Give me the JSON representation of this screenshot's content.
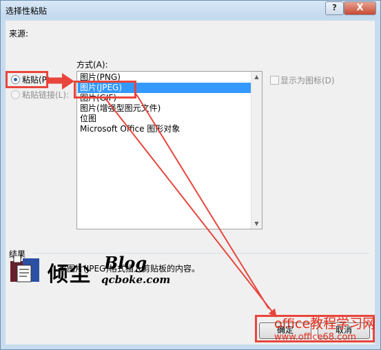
{
  "window": {
    "title": "选择性粘贴",
    "help_label": "?",
    "close_label": "X"
  },
  "source": {
    "label": "来源:"
  },
  "options": {
    "paste_label": "粘贴(P):",
    "paste_link_label": "粘贴链接(L):",
    "paste_selected": true
  },
  "format": {
    "label": "方式(A):",
    "items": [
      "图片(PNG)",
      "图片(JPEG)",
      "图片(GIF)",
      "图片(增强型图元文件)",
      "位图",
      "Microsoft Office 图形对象"
    ],
    "selected_index": 1
  },
  "display_as_icon": {
    "label": "显示为图标(D)",
    "checked": false
  },
  "result": {
    "label": "结果",
    "text": "以图片(JPEG)格式插入剪贴板的内容。"
  },
  "buttons": {
    "ok_label": "确定",
    "cancel_label": "取消"
  },
  "logo": {
    "chinese": "倾尘",
    "blog": "Blog",
    "domain": "qcboke.com"
  },
  "watermark": {
    "line1": "office教程学习网",
    "line2": "www.office68.com"
  },
  "colors": {
    "accent": "#3399ff",
    "annotation_red": "#e8453c",
    "close_button": "#c74a34"
  }
}
